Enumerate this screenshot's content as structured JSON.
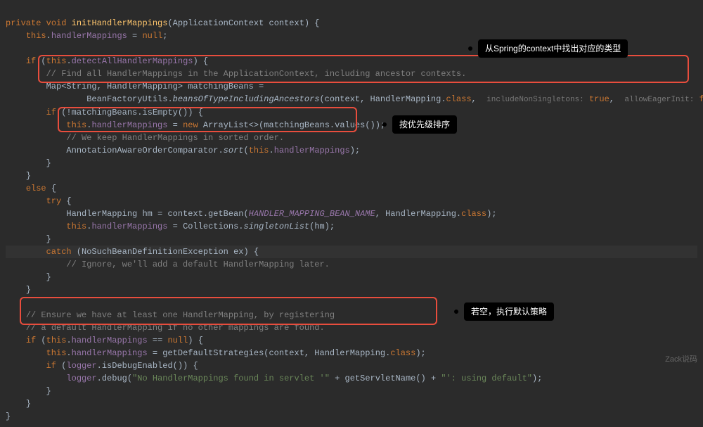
{
  "annotations": {
    "a1": "从Spring的context中找出对应的类型",
    "a2": "按优先级排序",
    "a3": "若空，执行默认策略"
  },
  "code": {
    "l1_private": "private",
    "l1_void": "void",
    "l1_method": "initHandlerMappings",
    "l1_params": "(ApplicationContext context) {",
    "l2_this": "this",
    "l2_dot": ".",
    "l2_field": "handlerMappings",
    "l2_rest": " = ",
    "l2_null": "null",
    "l2_semi": ";",
    "l4_if": "if",
    "l4_open": " (",
    "l4_this": "this",
    "l4_dot": ".",
    "l4_field": "detectAllHandlerMappings",
    "l4_close": ") {",
    "l5_comment": "// Find all HandlerMappings in the ApplicationContext, including ancestor contexts.",
    "l6_a": "Map<String, HandlerMapping> matchingBeans =",
    "l7_a": "BeanFactoryUtils.",
    "l7_method": "beansOfTypeIncludingAncestors",
    "l7_b": "(context, HandlerMapping.",
    "l7_class": "class",
    "l7_c": ", ",
    "l7_hint1": "includeNonSingletons:",
    "l7_true": " true",
    "l7_d": ", ",
    "l7_hint2": "allowEagerInit:",
    "l7_false": " false",
    "l7_e": ");",
    "l8_if": "if",
    "l8_rest": " (!matchingBeans.isEmpty()) {",
    "l9_this": "this",
    "l9_dot": ".",
    "l9_field": "handlerMappings",
    "l9_eq": " = ",
    "l9_new": "new",
    "l9_rest": " ArrayList<>(matchingBeans.values());",
    "l10_comment": "// We keep HandlerMappings in sorted order.",
    "l11_a": "AnnotationAwareOrderComparator.",
    "l11_sort": "sort",
    "l11_b": "(",
    "l11_this": "this",
    "l11_dot": ".",
    "l11_field": "handlerMappings",
    "l11_c": ");",
    "l12": "}",
    "l13": "}",
    "l14_else": "else",
    "l14_brace": " {",
    "l15_try": "try",
    "l15_brace": " {",
    "l16_a": "HandlerMapping hm = context.getBean(",
    "l16_const": "HANDLER_MAPPING_BEAN_NAME",
    "l16_b": ", HandlerMapping.",
    "l16_class": "class",
    "l16_c": ");",
    "l17_this": "this",
    "l17_dot": ".",
    "l17_field": "handlerMappings",
    "l17_eq": " = Collections.",
    "l17_method": "singletonList",
    "l17_rest": "(hm);",
    "l18": "}",
    "l19_catch": "catch",
    "l19_rest": " (NoSuchBeanDefinitionException ex) {",
    "l20_comment": "// Ignore, we'll add a default HandlerMapping later.",
    "l21": "}",
    "l22": "}",
    "l24_comment": "// Ensure we have at least one HandlerMapping, by registering",
    "l25_comment": "// a default HandlerMapping if no other mappings are found.",
    "l26_if": "if",
    "l26_a": " (",
    "l26_this": "this",
    "l26_dot": ".",
    "l26_field": "handlerMappings",
    "l26_b": " == ",
    "l26_null": "null",
    "l26_c": ") {",
    "l27_this": "this",
    "l27_dot": ".",
    "l27_field": "handlerMappings",
    "l27_rest": " = getDefaultStrategies(context, HandlerMapping.",
    "l27_class": "class",
    "l27_c": ");",
    "l28_if": "if",
    "l28_a": " (",
    "l28_logger": "logger",
    "l28_rest": ".isDebugEnabled()) {",
    "l29_logger": "logger",
    "l29_a": ".debug(",
    "l29_str1": "\"No HandlerMappings found in servlet '\"",
    "l29_b": " + getServletName() + ",
    "l29_str2": "\"': using default\"",
    "l29_c": ");",
    "l30": "}",
    "l31": "}",
    "l32": "}"
  },
  "watermark": "Zack说码"
}
